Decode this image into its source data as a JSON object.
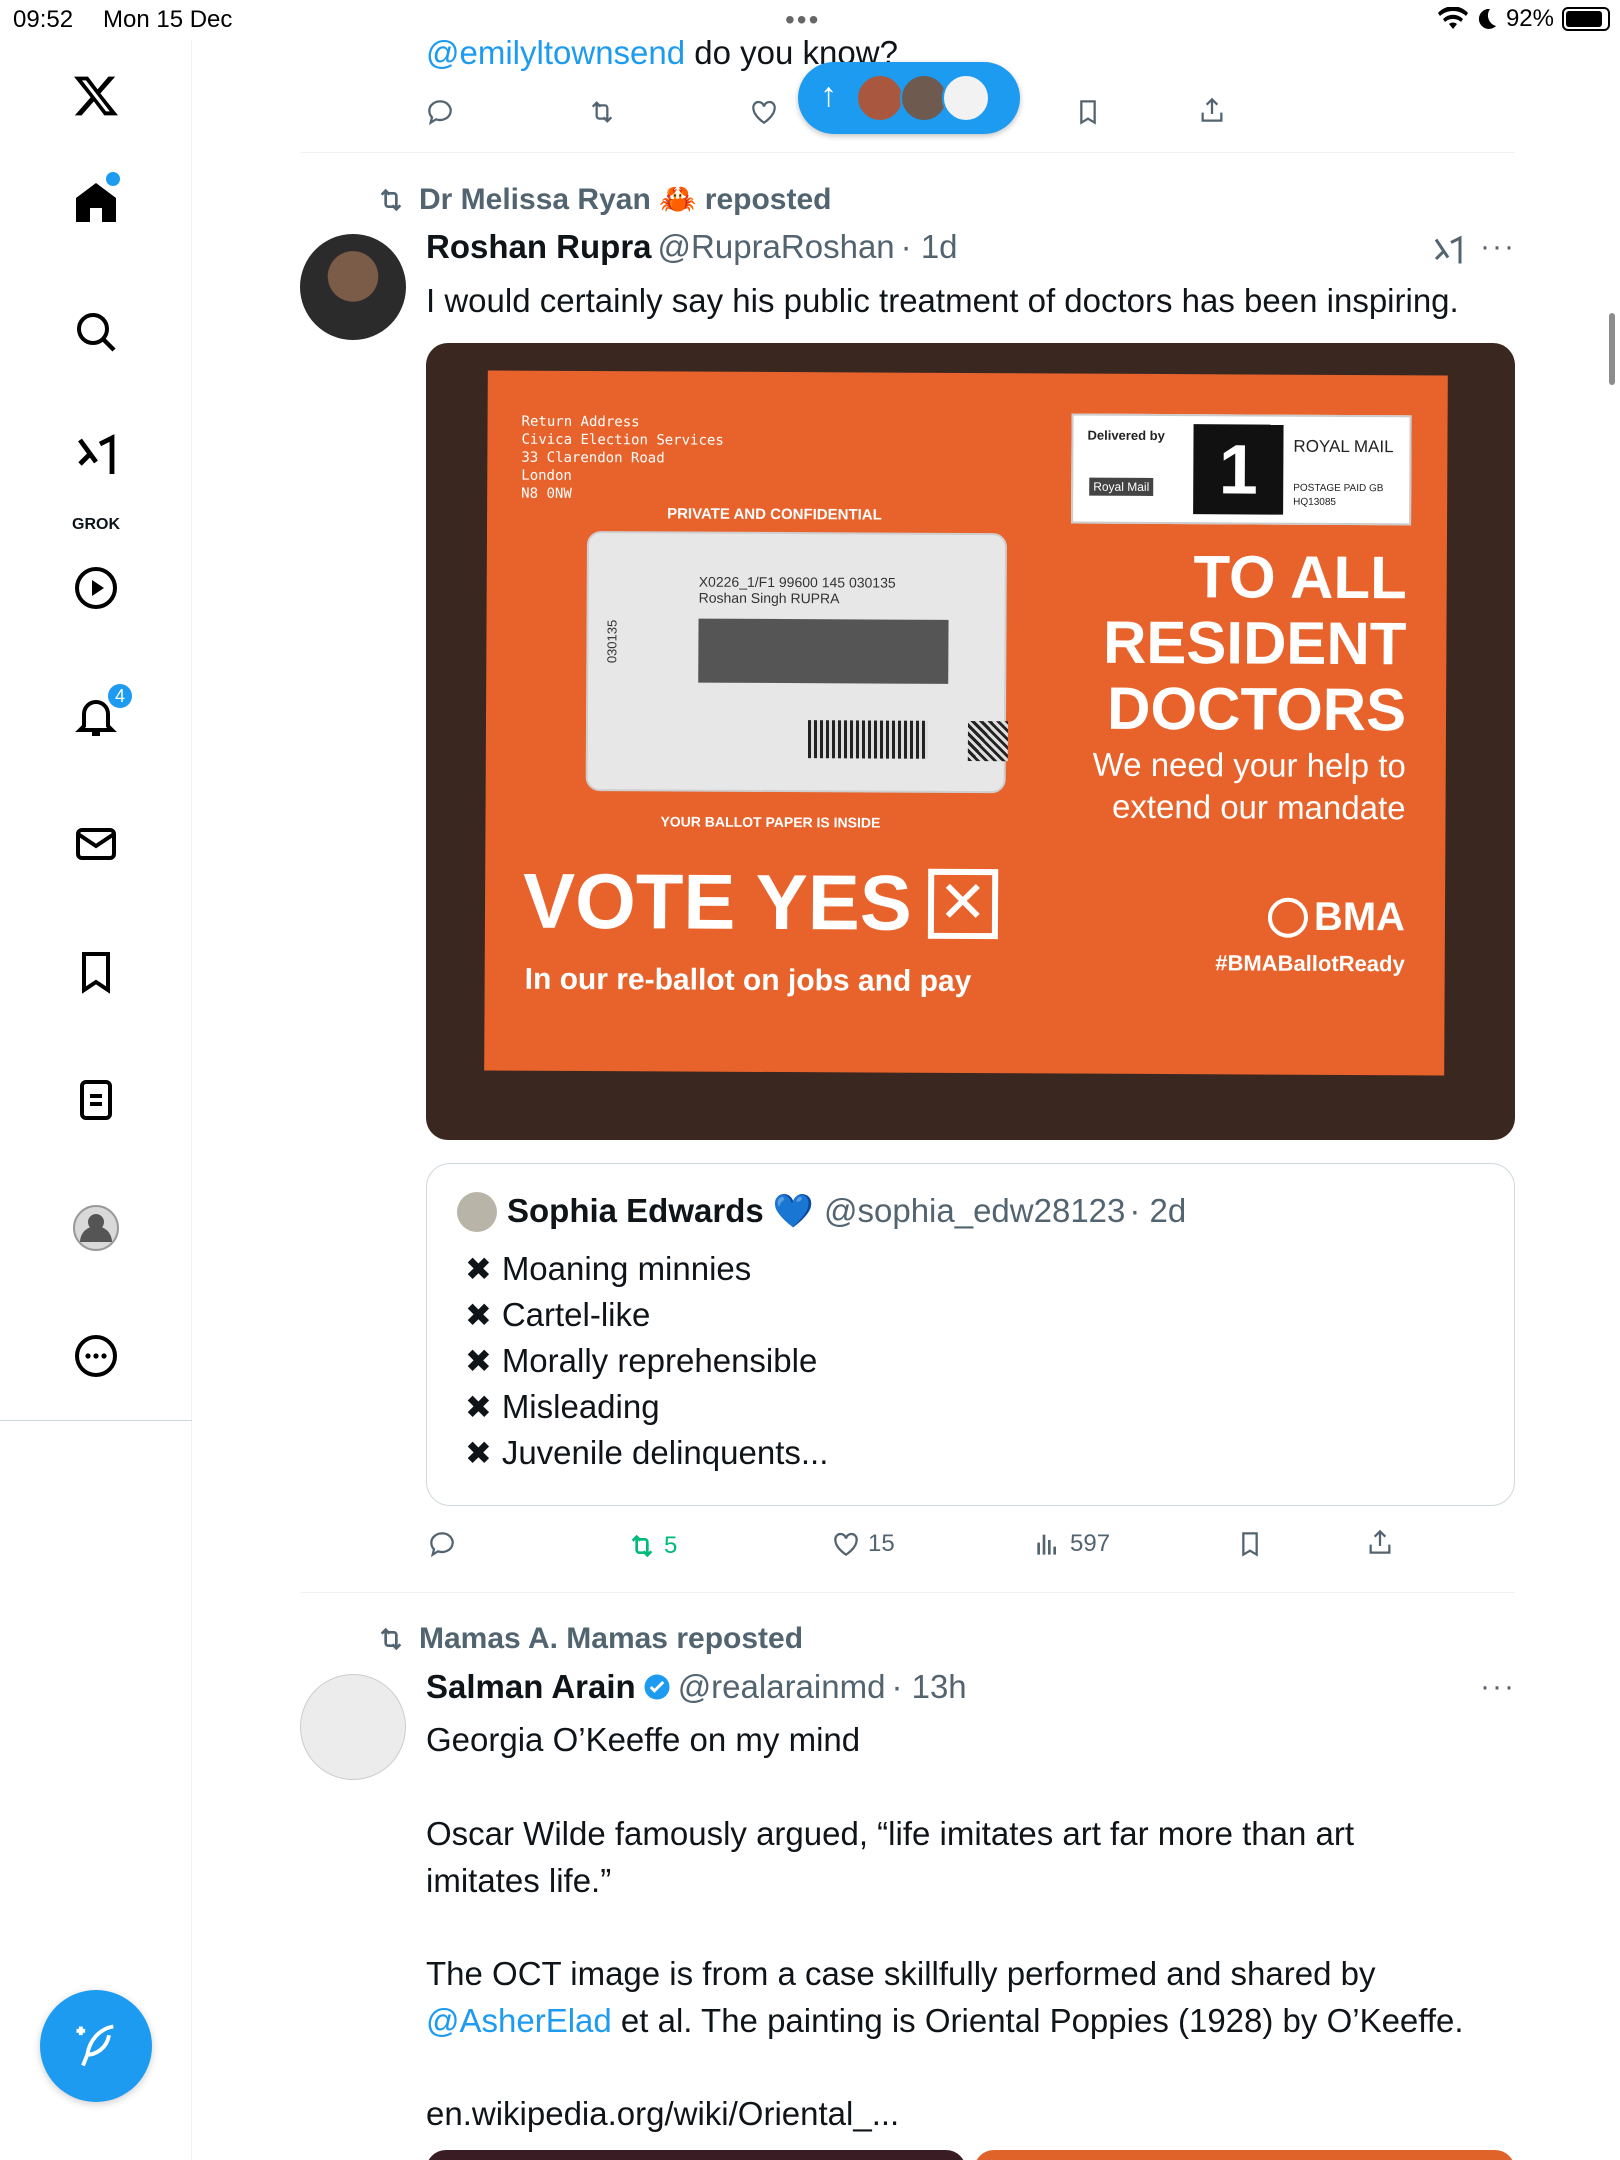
{
  "status_bar": {
    "time": "09:52",
    "date": "Mon 15 Dec",
    "battery": "92%"
  },
  "sidebar": {
    "grok_label": "GROK",
    "notifications_count": "4"
  },
  "top_tweet": {
    "mention": "@emilyltownsend",
    "text": " do you know?"
  },
  "tweet1": {
    "reposted_by": "Dr Melissa Ryan 🦀 reposted",
    "name": "Roshan Rupra",
    "handle": "@RupraRoshan",
    "time": "· 1d",
    "text": "I would certainly say his public treatment of doctors has been inspiring.",
    "envelope": {
      "return_address": [
        "Return Address",
        "Civica Election Services",
        "33 Clarendon Road",
        "London",
        "N8 0NW"
      ],
      "private": "PRIVATE AND CONFIDENTIAL",
      "address_line1": "X0226_1/F1 99600 145 030135",
      "address_line2": "Roshan Singh RUPRA",
      "vertical_code": "030135",
      "ballot_inside": "YOUR BALLOT PAPER IS INSIDE",
      "delivered_by": "Delivered by",
      "royal_mail": "ROYAL MAIL",
      "royal_mail_small": "Royal Mail",
      "postage": "POSTAGE PAID GB",
      "postage_code": "HQ13085",
      "headline": [
        "TO ALL",
        "RESIDENT",
        "DOCTORS"
      ],
      "sub": [
        "We need your help to",
        "extend our mandate"
      ],
      "vote": "VOTE YES",
      "ballot_line": "In our re-ballot on jobs and pay",
      "bma": "BMA",
      "hashtag": "#BMABallotReady"
    },
    "quote": {
      "name": "Sophia Edwards 💙",
      "handle": "@sophia_edw28123",
      "time": "· 2d",
      "items": [
        "Moaning minnies",
        "Cartel-like",
        "Morally reprehensible",
        "Misleading",
        "Juvenile delinquents..."
      ]
    },
    "actions": {
      "reposts": "5",
      "likes": "15",
      "views": "597"
    }
  },
  "tweet2": {
    "reposted_by": "Mamas A. Mamas reposted",
    "name": "Salman Arain",
    "handle": "@realarainmd",
    "time": "· 13h",
    "line1": "Georgia O’Keeffe on my mind",
    "line2": "Oscar Wilde famously argued, “life imitates art far more than art",
    "line3": "imitates life.”",
    "line4": "The OCT image is from a case skillfully performed and shared by",
    "mention": "@AsherElad",
    "line5": " et al. The painting is Oriental Poppies (1928) by O’Keeffe.",
    "link": "en.wikipedia.org/wiki/Oriental_..."
  },
  "colors": {
    "accent": "#1d9bf0",
    "repost_green": "#00ba7c",
    "muted": "#536471",
    "envelope_orange": "#e8632b"
  }
}
